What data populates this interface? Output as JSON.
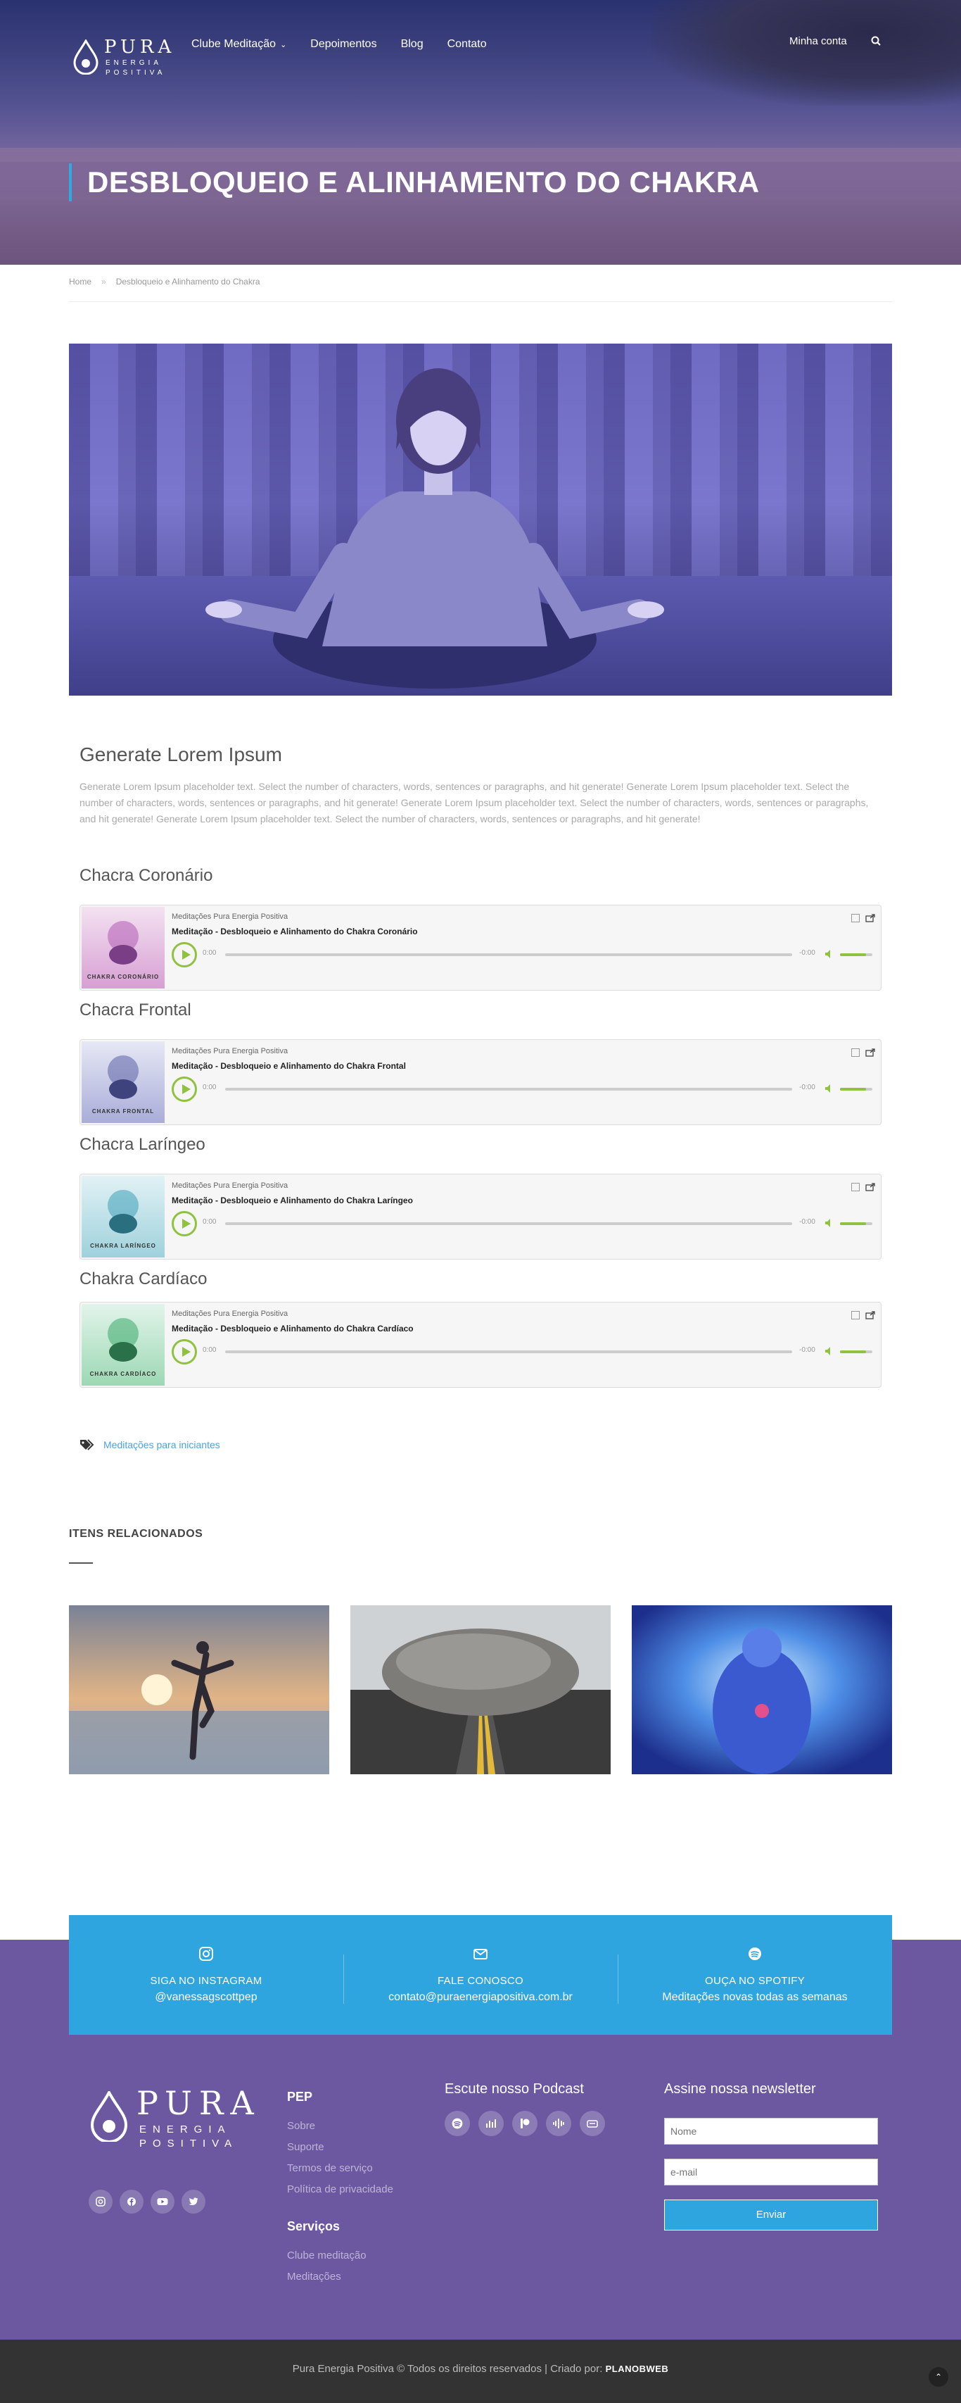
{
  "header": {
    "logo": {
      "name": "PURA",
      "line1": "ENERGIA",
      "line2": "POSITIVA"
    },
    "nav": [
      {
        "label": "Clube Meditação"
      },
      {
        "label": "Depoimentos"
      },
      {
        "label": "Blog"
      },
      {
        "label": "Contato"
      }
    ],
    "account_label": "Minha conta",
    "title": "DESBLOQUEIO E ALINHAMENTO DO CHAKRA"
  },
  "breadcrumb": {
    "home": "Home",
    "sep": "»",
    "current": "Desbloqueio e Alinhamento do Chakra"
  },
  "article": {
    "heading": "Generate Lorem Ipsum",
    "body": "Generate Lorem Ipsum placeholder text. Select the number of characters, words, sentences or paragraphs, and hit generate! Generate Lorem Ipsum placeholder text. Select the number of characters, words, sentences or paragraphs, and hit generate! Generate Lorem Ipsum placeholder text. Select the number of characters, words, sentences or paragraphs, and hit generate! Generate Lorem Ipsum placeholder text. Select the number of characters, words, sentences or paragraphs, and hit generate!"
  },
  "players": [
    {
      "heading": "Chacra Coronário",
      "brand": "Meditações Pura Energia Positiva",
      "track": "Meditação - Desbloqueio e Alinhamento do Chakra Coronário",
      "art_label": "CHAKRA CORONÁRIO",
      "art_color": "#b35bb6",
      "time": "0:00",
      "remaining": "-0:00",
      "volume": 0.8
    },
    {
      "heading": "Chacra Frontal",
      "brand": "Meditações Pura Energia Positiva",
      "track": "Meditação - Desbloqueio e Alinhamento do Chakra Frontal",
      "art_label": "CHAKRA FRONTAL",
      "art_color": "#5d63a6",
      "time": "0:00",
      "remaining": "-0:00",
      "volume": 0.8
    },
    {
      "heading": "Chacra Laríngeo",
      "brand": "Meditações Pura Energia Positiva",
      "track": "Meditação - Desbloqueio e Alinhamento do Chakra Laríngeo",
      "art_label": "CHAKRA LARÍNGEO",
      "art_color": "#3fa1b8",
      "time": "0:00",
      "remaining": "-0:00",
      "volume": 0.8
    },
    {
      "heading": "Chakra Cardíaco",
      "brand": "Meditações Pura Energia Positiva",
      "track": "Meditação - Desbloqueio e Alinhamento do Chakra Cardíaco",
      "art_label": "CHAKRA CARDÍACO",
      "art_color": "#3daa6b",
      "time": "0:00",
      "remaining": "-0:00",
      "volume": 0.8
    }
  ],
  "tags": {
    "link": "Meditações para iniciantes"
  },
  "related": {
    "heading": "ITENS RELACIONADOS"
  },
  "contact": {
    "instagram": {
      "label": "SIGA NO INSTAGRAM",
      "value": "@vanessagscottpep"
    },
    "email": {
      "label": "FALE CONOSCO",
      "value": "contato@puraenergiapositiva.com.br"
    },
    "spotify": {
      "label": "OUÇA NO SPOTIFY",
      "value": "Meditações novas todas as semanas"
    }
  },
  "footer": {
    "pep": {
      "title": "PEP",
      "links": [
        "Sobre",
        "Suporte",
        "Termos de serviço",
        "Política de privacidade"
      ]
    },
    "services": {
      "title": "Serviços",
      "links": [
        "Clube meditação",
        "Meditações"
      ]
    },
    "podcast_title": "Escute nosso Podcast",
    "newsletter": {
      "title": "Assine nossa newsletter",
      "name_placeholder": "Nome",
      "email_placeholder": "e-mail",
      "button": "Enviar"
    },
    "copyright": "Pura Energia Positiva © Todos os direitos reservados | Criado por:",
    "creator": "PLANOBWEB"
  },
  "colors": {
    "accent": "#2fa5e0",
    "footer": "#6b58a1",
    "player_green": "#8fc23e"
  }
}
